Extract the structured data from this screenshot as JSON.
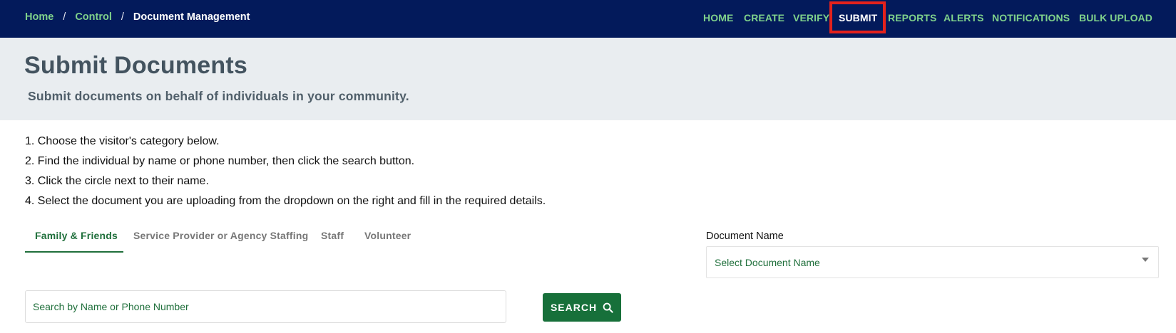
{
  "breadcrumb": {
    "items": [
      "Home",
      "Control"
    ],
    "current": "Document Management",
    "separator": "/"
  },
  "nav": {
    "items": [
      "HOME",
      "CREATE",
      "VERIFY",
      "SUBMIT",
      "REPORTS",
      "ALERTS",
      "NOTIFICATIONS",
      "BULK UPLOAD"
    ],
    "active": "SUBMIT"
  },
  "hero": {
    "title": "Submit Documents",
    "subtitle": "Submit documents on behalf of individuals in your community."
  },
  "steps": [
    "1. Choose the visitor's category below.",
    "2. Find the individual by name or phone number, then click the search button.",
    "3. Click the circle next to their name.",
    "4. Select the document you are uploading from the dropdown on the right and fill in the required details."
  ],
  "tabs": {
    "items": [
      "Family & Friends",
      "Service Provider or Agency Staffing",
      "Staff",
      "Volunteer"
    ],
    "active": "Family & Friends"
  },
  "document": {
    "label": "Document Name",
    "placeholder": "Select Document Name"
  },
  "search": {
    "placeholder": "Search by Name or Phone Number",
    "value": "",
    "button_label": "SEARCH",
    "icon": "search-icon"
  },
  "colors": {
    "topbar": "#031a5b",
    "nav_link": "#7fd18b",
    "highlight": "#e4221c",
    "hero_bg": "#e9edf0",
    "accent_green": "#17703a"
  }
}
